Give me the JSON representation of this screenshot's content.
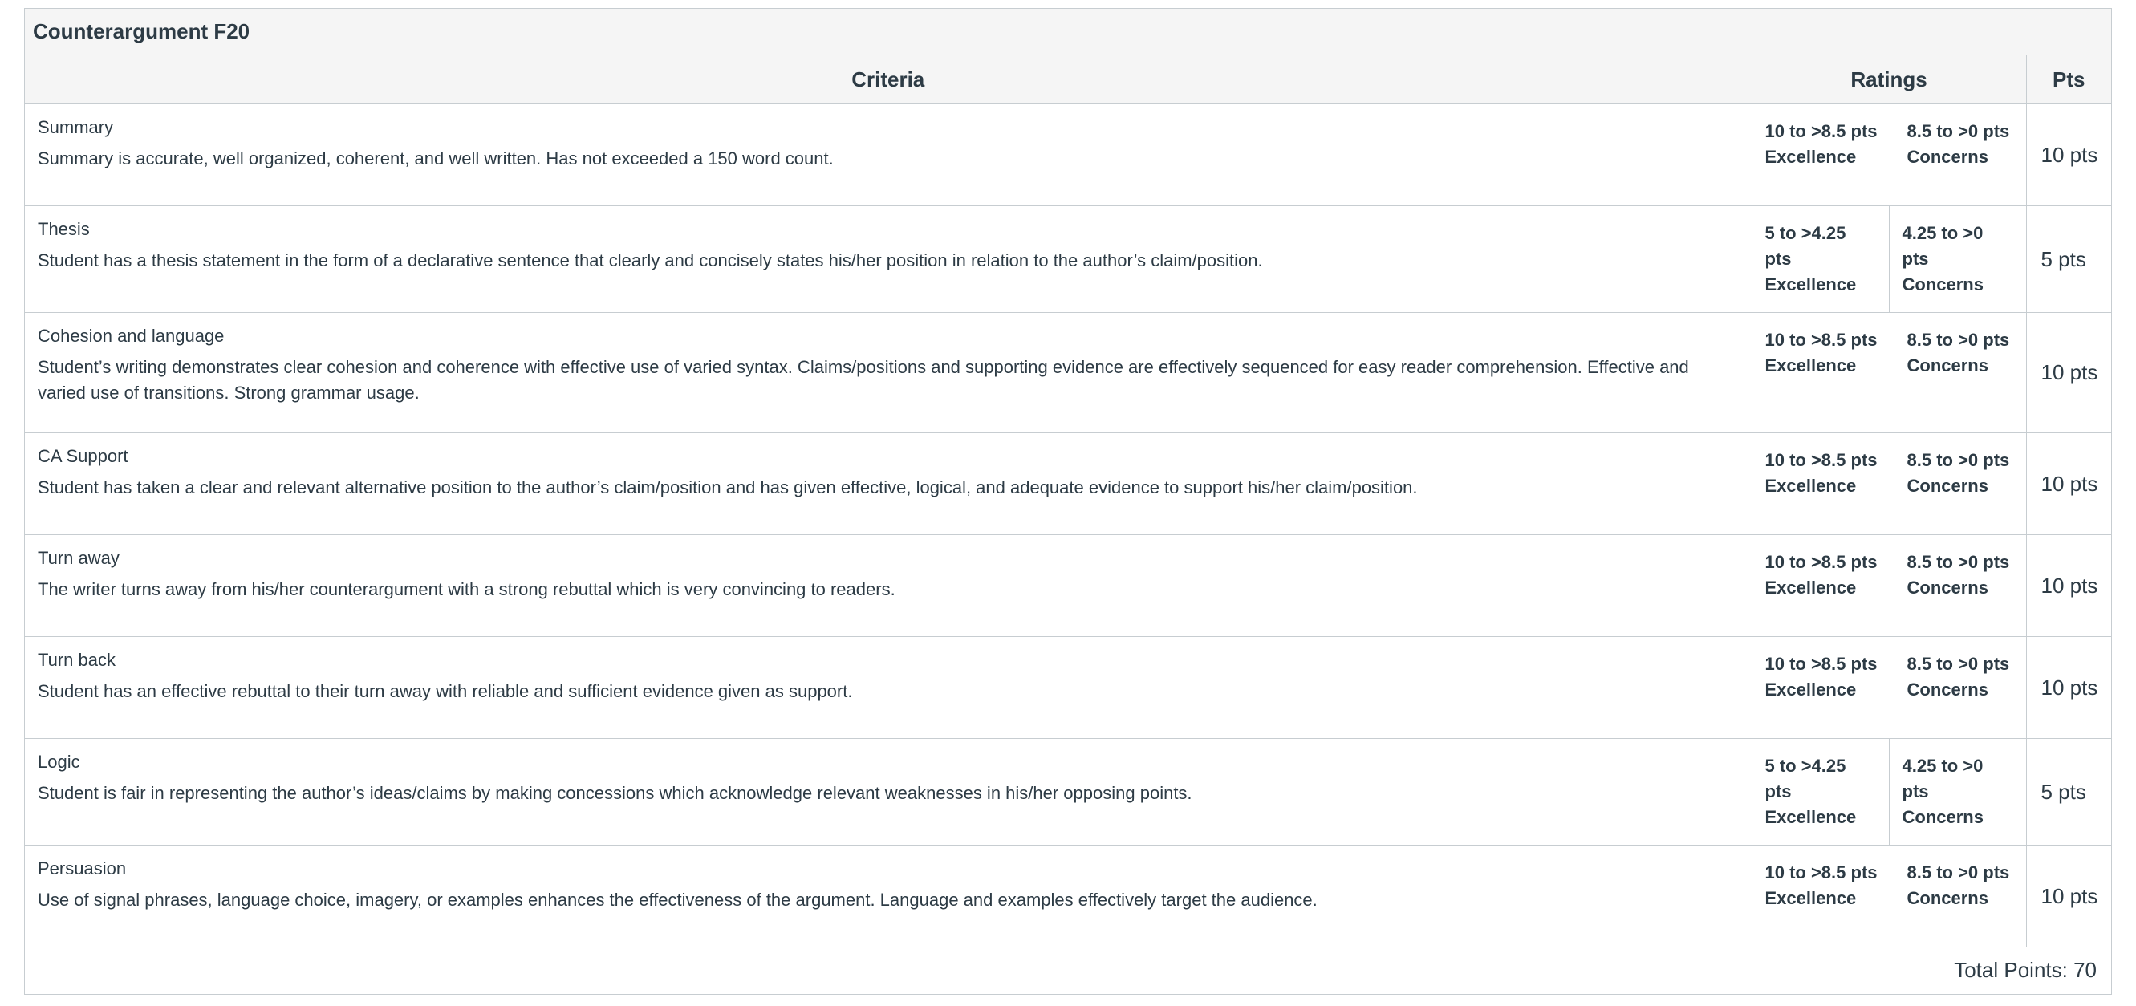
{
  "rubric": {
    "title": "Counterargument F20",
    "headers": {
      "criteria": "Criteria",
      "ratings": "Ratings",
      "pts": "Pts"
    },
    "rows": [
      {
        "title": "Summary",
        "description": "Summary is accurate, well organized, coherent, and well written. Has not exceeded a 150 word count.",
        "ratings": [
          {
            "range": "10 to >8.5 pts",
            "label": "Excellence"
          },
          {
            "range": "8.5 to >0 pts",
            "label": "Concerns"
          }
        ],
        "pts": "10 pts"
      },
      {
        "title": "Thesis",
        "description": "Student has a thesis statement in the form of a declarative sentence that clearly and concisely states his/her position in relation to the author’s claim/position.",
        "ratings": [
          {
            "range": "5 to >4.25 pts",
            "label": "Excellence"
          },
          {
            "range": "4.25 to >0 pts",
            "label": "Concerns"
          }
        ],
        "pts": "5 pts"
      },
      {
        "title": "Cohesion and language",
        "description": "Student’s writing demonstrates clear cohesion and coherence with effective use of varied syntax. Claims/positions and supporting evidence are effectively sequenced for easy reader comprehension. Effective and varied use of transitions. Strong grammar usage.",
        "ratings": [
          {
            "range": "10 to >8.5 pts",
            "label": "Excellence"
          },
          {
            "range": "8.5 to >0 pts",
            "label": "Concerns"
          }
        ],
        "pts": "10 pts"
      },
      {
        "title": "CA Support",
        "description": "Student has taken a clear and relevant alternative position to the author’s claim/position and has given effective, logical, and adequate evidence to support his/her claim/position.",
        "ratings": [
          {
            "range": "10 to >8.5 pts",
            "label": "Excellence"
          },
          {
            "range": "8.5 to >0 pts",
            "label": "Concerns"
          }
        ],
        "pts": "10 pts"
      },
      {
        "title": "Turn away",
        "description": "The writer turns away from his/her counterargument with a strong rebuttal which is very convincing to readers.",
        "ratings": [
          {
            "range": "10 to >8.5 pts",
            "label": "Excellence"
          },
          {
            "range": "8.5 to >0 pts",
            "label": "Concerns"
          }
        ],
        "pts": "10 pts"
      },
      {
        "title": "Turn back",
        "description": "Student has an effective rebuttal to their turn away with reliable and sufficient evidence given as support.",
        "ratings": [
          {
            "range": "10 to >8.5 pts",
            "label": "Excellence"
          },
          {
            "range": "8.5 to >0 pts",
            "label": "Concerns"
          }
        ],
        "pts": "10 pts"
      },
      {
        "title": "Logic",
        "description": "Student is fair in representing the author’s ideas/claims by making concessions which acknowledge relevant weaknesses in his/her opposing points.",
        "ratings": [
          {
            "range": "5 to >4.25 pts",
            "label": "Excellence"
          },
          {
            "range": "4.25 to >0 pts",
            "label": "Concerns"
          }
        ],
        "pts": "5 pts"
      },
      {
        "title": "Persuasion",
        "description": "Use of signal phrases, language choice, imagery, or examples enhances the effectiveness of the argument. Language and examples effectively target the audience.",
        "ratings": [
          {
            "range": "10 to >8.5 pts",
            "label": "Excellence"
          },
          {
            "range": "8.5 to >0 pts",
            "label": "Concerns"
          }
        ],
        "pts": "10 pts"
      }
    ],
    "total": "Total Points: 70"
  }
}
